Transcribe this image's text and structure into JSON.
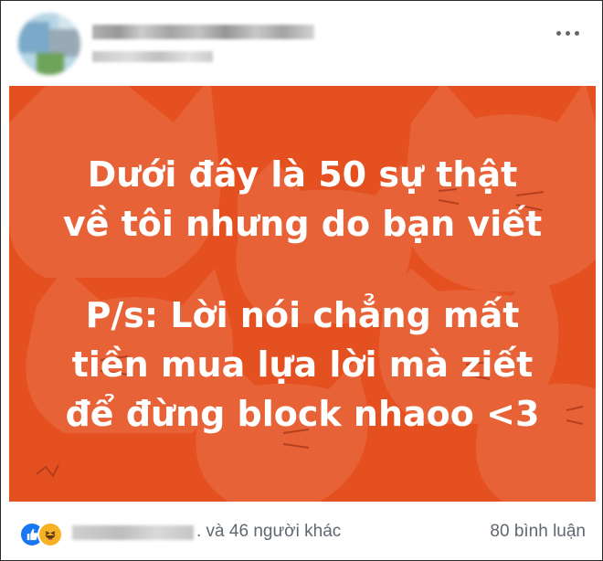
{
  "post": {
    "lines_block1": [
      "Dưới đây là 50 sự thật",
      "về tôi nhưng do bạn viết"
    ],
    "lines_block2": [
      "P/s: Lời nói chẳng mất",
      "tiền mua lựa lời mà ziết",
      "để đừng block nhaoo <3"
    ],
    "background_color": "#e4501f",
    "text_color": "#ffffff"
  },
  "footer": {
    "reactions": [
      "like-icon",
      "haha-icon"
    ],
    "reaction_text": ". và 46 người khác",
    "comments_text": "80 bình luận"
  },
  "colors": {
    "brand_blue": "#1877f2",
    "muted_text": "#606770"
  }
}
